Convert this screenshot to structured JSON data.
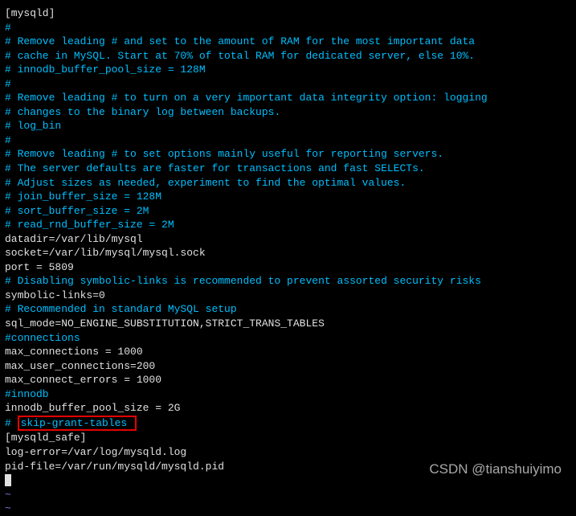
{
  "config": {
    "section_mysqld": "[mysqld]",
    "c1": "#",
    "c2": "# Remove leading # and set to the amount of RAM for the most important data",
    "c3": "# cache in MySQL. Start at 70% of total RAM for dedicated server, else 10%.",
    "c4": "# innodb_buffer_pool_size = 128M",
    "c5": "#",
    "c6": "# Remove leading # to turn on a very important data integrity option: logging",
    "c7": "# changes to the binary log between backups.",
    "c8": "# log_bin",
    "c9": "#",
    "c10": "# Remove leading # to set options mainly useful for reporting servers.",
    "c11": "# The server defaults are faster for transactions and fast SELECTs.",
    "c12": "# Adjust sizes as needed, experiment to find the optimal values.",
    "c13": "# join_buffer_size = 128M",
    "c14": "# sort_buffer_size = 2M",
    "c15": "# read_rnd_buffer_size = 2M",
    "datadir": "datadir=/var/lib/mysql",
    "socket": "socket=/var/lib/mysql/mysql.sock",
    "port": "port = 5809",
    "disable_comment": "# Disabling symbolic-links is recommended to prevent assorted security risks",
    "symlinks": "symbolic-links=0",
    "blank1": "",
    "rec_comment": "# Recommended in standard MySQL setup",
    "sql_mode": "sql_mode=NO_ENGINE_SUBSTITUTION,STRICT_TRANS_TABLES",
    "blank2": "",
    "conn_comment": "#connections",
    "max_conn": "max_connections = 1000",
    "max_user_conn": "max_user_connections=200",
    "max_conn_err": "max_connect_errors = 1000",
    "blank3": "",
    "innodb_comment": "#innodb",
    "innodb_pool": "innodb_buffer_pool_size = 2G",
    "skip_hash": "# ",
    "skip_grant": "skip-grant-tables ",
    "blank4": "",
    "section_safe": "[mysqld_safe]",
    "log_error": "log-error=/var/log/mysqld.log",
    "pid_file": "pid-file=/var/run/mysqld/mysqld.pid",
    "tilde": "~",
    "tilde2": "~"
  },
  "watermark": "CSDN @tianshuiyimo"
}
